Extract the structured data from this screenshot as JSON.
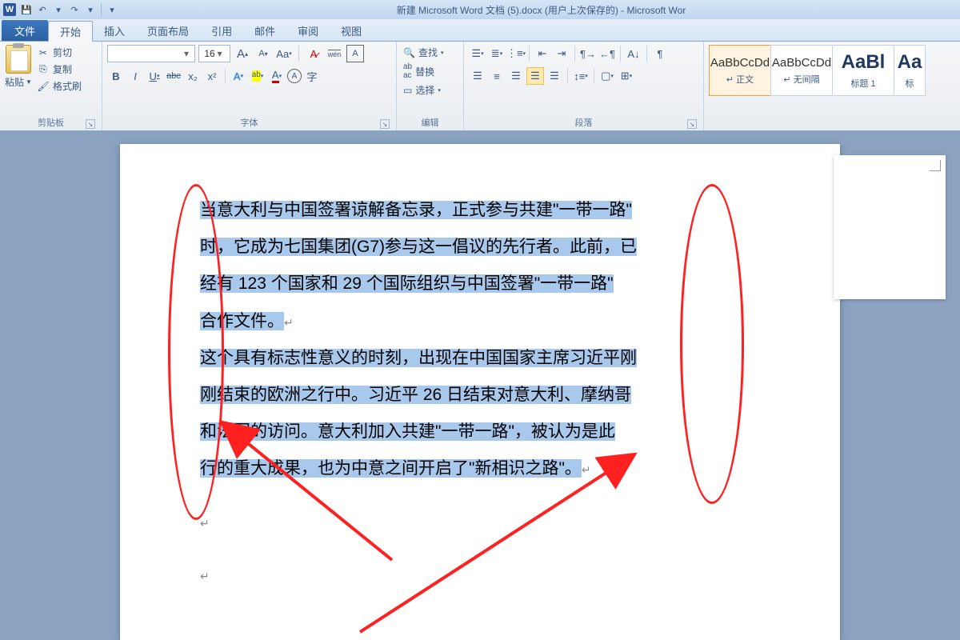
{
  "title": "新建 Microsoft Word 文档 (5).docx (用户上次保存的) - Microsoft Wor",
  "qat": {
    "save": "💾",
    "undo": "↶",
    "redo": "↷"
  },
  "tabs": {
    "file": "文件",
    "home": "开始",
    "insert": "插入",
    "layout": "页面布局",
    "references": "引用",
    "mail": "邮件",
    "review": "审阅",
    "view": "视图"
  },
  "clipboard": {
    "paste": "粘贴",
    "cut": "剪切",
    "copy": "复制",
    "format_painter": "格式刷",
    "label": "剪贴板"
  },
  "font": {
    "family": "",
    "size": "16",
    "grow": "A",
    "shrink": "A",
    "aa": "Aa",
    "clear": "A",
    "pinyin": "wén",
    "border": "A",
    "bold": "B",
    "italic": "I",
    "underline": "U",
    "strike": "abc",
    "sub": "x₂",
    "sup": "x²",
    "texteffect": "A",
    "highlight": "ab",
    "fontcolor": "A",
    "circled": "A",
    "charfmt": "字",
    "label": "字体"
  },
  "editing": {
    "find": "查找",
    "replace": "替换",
    "select": "选择",
    "label": "编辑"
  },
  "paragraph": {
    "label": "段落"
  },
  "styles": {
    "normal": {
      "preview": "AaBbCcDd",
      "name": "正文"
    },
    "nospace": {
      "preview": "AaBbCcDd",
      "name": "无间隔"
    },
    "h1": {
      "preview": "AaBl",
      "name": "标题 1"
    },
    "h2": {
      "preview": "Aa",
      "name": "标"
    }
  },
  "doc": {
    "p1a": "当意大利与中国签署谅解备忘录，正式参与共建\"一带一路\"",
    "p1b": "时，它成为七国集团(G7)参与这一倡议的先行者。此前，已",
    "p1c": "经有 123 个国家和 29 个国际组织与中国签署\"一带一路\"",
    "p1d": "合作文件。",
    "p2a": "这个具有标志性意义的时刻，出现在中国国家主席习近平刚",
    "p2b": "刚结束的欧洲之行中。习近平 26 日结束对意大利、摩纳哥",
    "p2c": "和法国的访问。意大利加入共建\"一带一路\"，被认为是此",
    "p2d": "行的重大成果，也为中意之间开启了\"新相识之路\"。"
  }
}
